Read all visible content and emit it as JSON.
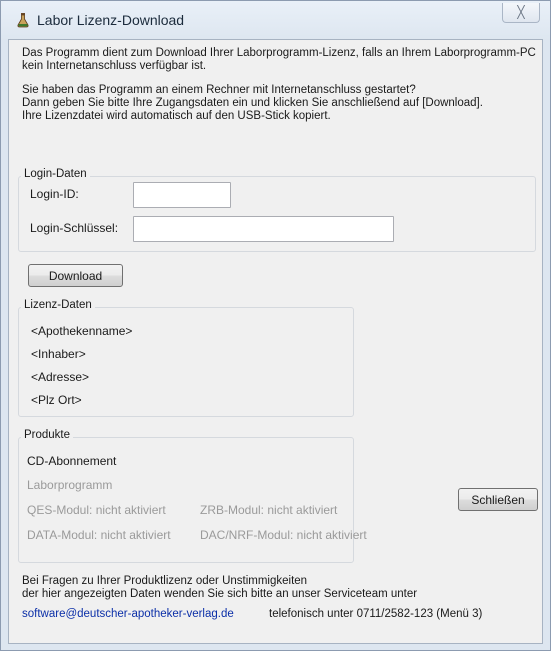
{
  "window": {
    "title": "Labor Lizenz-Download",
    "close_glyph": "╳"
  },
  "intro": {
    "line1": "Das Programm dient zum Download Ihrer Laborprogramm-Lizenz, falls an Ihrem Laborprogramm-PC",
    "line2": "kein Internetanschluss verfügbar ist.",
    "line3": "Sie haben das Programm an einem Rechner mit Internetanschluss gestartet?",
    "line4": "Dann geben Sie bitte Ihre Zugangsdaten ein und klicken Sie anschließend auf [Download].",
    "line5": "Ihre Lizenzdatei wird automatisch auf den USB-Stick kopiert."
  },
  "login": {
    "group_title": "Login-Daten",
    "id_label": "Login-ID:",
    "id_value": "",
    "key_label": "Login-Schlüssel:",
    "key_value": ""
  },
  "download_button": "Download",
  "license": {
    "group_title": "Lizenz-Daten",
    "pharmacy_name": "<Apothekenname>",
    "owner": "<Inhaber>",
    "address": "<Adresse>",
    "zip_city": "<Plz Ort>"
  },
  "products": {
    "group_title": "Produkte",
    "cd_subscription": "CD-Abonnement",
    "lab_program": "Laborprogramm",
    "qes_module": "QES-Modul: nicht aktiviert",
    "zrb_module": "ZRB-Modul: nicht aktiviert",
    "data_module": "DATA-Modul: nicht aktiviert",
    "dac_nrf_module": "DAC/NRF-Modul: nicht aktiviert"
  },
  "close_button": "Schließen",
  "footer": {
    "line1": "Bei Fragen zu Ihrer Produktlizenz oder Unstimmigkeiten",
    "line2": "der hier angezeigten Daten wenden Sie sich bitte an unser Serviceteam unter",
    "email": "software@deutscher-apotheker-verlag.de",
    "phone": "telefonisch unter 0711/2582-123 (Menü 3)"
  },
  "colors": {
    "link": "#0b2fa8",
    "disabled_text": "#9a9a9a",
    "dialog_background": "#f0f0f0"
  },
  "icons": {
    "app": "lab-flask-icon",
    "close": "close-icon"
  }
}
